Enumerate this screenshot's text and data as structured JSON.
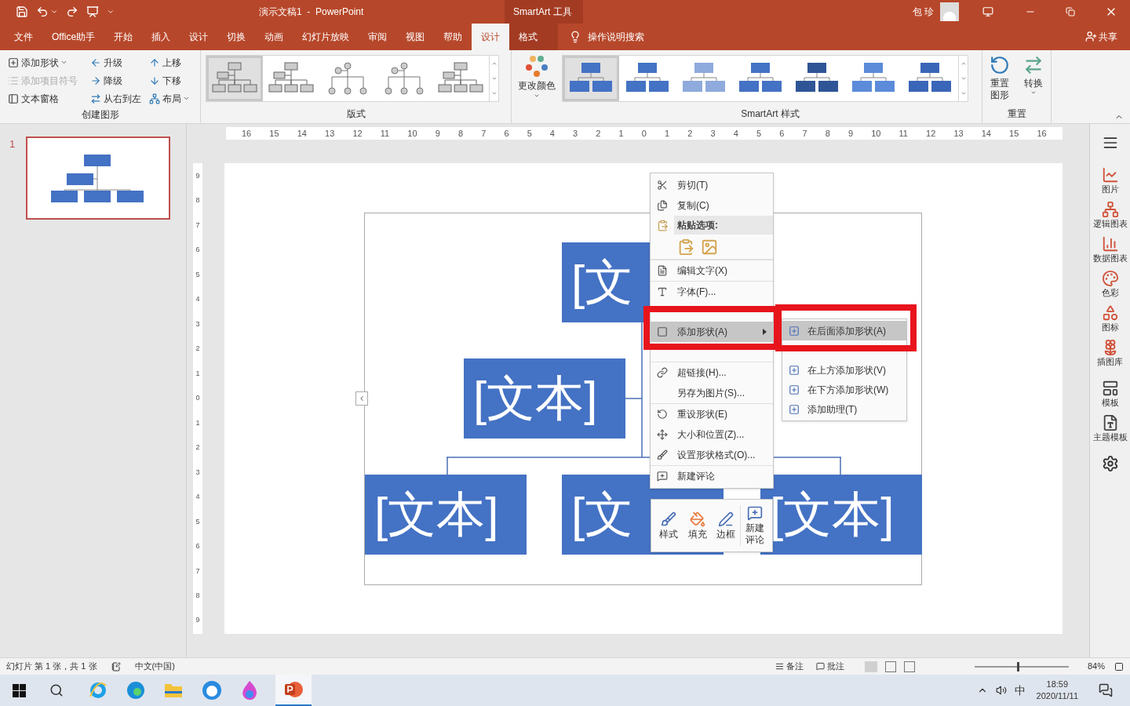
{
  "title_bar": {
    "title": "演示文稿1  -  PowerPoint",
    "context_group": "SmartArt 工具",
    "user": "包 珍"
  },
  "tabs": [
    {
      "label": "文件",
      "selected": false,
      "kind": "main"
    },
    {
      "label": "Office助手",
      "selected": false,
      "kind": "main"
    },
    {
      "label": "开始",
      "selected": false,
      "kind": "main"
    },
    {
      "label": "插入",
      "selected": false,
      "kind": "main"
    },
    {
      "label": "设计",
      "selected": false,
      "kind": "main"
    },
    {
      "label": "切换",
      "selected": false,
      "kind": "main"
    },
    {
      "label": "动画",
      "selected": false,
      "kind": "main"
    },
    {
      "label": "幻灯片放映",
      "selected": false,
      "kind": "main"
    },
    {
      "label": "审阅",
      "selected": false,
      "kind": "main"
    },
    {
      "label": "视图",
      "selected": false,
      "kind": "main"
    },
    {
      "label": "帮助",
      "selected": false,
      "kind": "main"
    },
    {
      "label": "设计",
      "selected": true,
      "kind": "context"
    },
    {
      "label": "格式",
      "selected": false,
      "kind": "context"
    }
  ],
  "search": "操作说明搜索",
  "share": "共享",
  "create_group": {
    "label": "创建图形",
    "items": [
      {
        "label": "添加形状",
        "disabled": false,
        "dropdown": true
      },
      {
        "label": "添加项目符号",
        "disabled": true,
        "dropdown": false
      },
      {
        "label": "文本窗格",
        "disabled": false,
        "dropdown": false
      },
      {
        "label": "升级",
        "disabled": false,
        "dropdown": false
      },
      {
        "label": "降级",
        "disabled": false,
        "dropdown": false
      },
      {
        "label": "从右到左",
        "disabled": false,
        "dropdown": false
      },
      {
        "label": "上移",
        "disabled": false,
        "dropdown": false
      },
      {
        "label": "下移",
        "disabled": false,
        "dropdown": false
      },
      {
        "label": "布局",
        "disabled": false,
        "dropdown": true
      }
    ]
  },
  "layout_group": {
    "label": "版式",
    "layouts": [
      {
        "selected": true
      },
      {
        "selected": false
      },
      {
        "selected": false
      },
      {
        "selected": false
      },
      {
        "selected": false
      }
    ]
  },
  "change_colors": "更改颜色",
  "styles_group": {
    "label": "SmartArt 样式",
    "styles": [
      {
        "selected": true
      },
      {
        "selected": false
      },
      {
        "selected": false
      },
      {
        "selected": false
      },
      {
        "selected": false
      },
      {
        "selected": false
      },
      {
        "selected": false
      }
    ]
  },
  "reset_group": {
    "label": "重置",
    "buttons": [
      "重置图形",
      "转换"
    ]
  },
  "slides": [
    {
      "number": "1",
      "selected": true
    }
  ],
  "ruler_h": [
    "16",
    "15",
    "14",
    "13",
    "12",
    "11",
    "10",
    "9",
    "8",
    "7",
    "6",
    "5",
    "4",
    "3",
    "2",
    "1",
    "0",
    "1",
    "2",
    "3",
    "4",
    "5",
    "6",
    "7",
    "8",
    "9",
    "10",
    "11",
    "12",
    "13",
    "14",
    "15",
    "16"
  ],
  "ruler_v": [
    "9",
    "8",
    "7",
    "6",
    "5",
    "4",
    "3",
    "2",
    "1",
    "0",
    "1",
    "2",
    "3",
    "4",
    "5",
    "6",
    "7",
    "8",
    "9"
  ],
  "smartart_nodes": [
    "[文",
    "[文本]",
    "[文本]",
    "[文",
    "[文本]"
  ],
  "context_menu": [
    {
      "kind": "item",
      "label": "剪切(T)",
      "selected": false
    },
    {
      "kind": "item",
      "label": "复制(C)",
      "selected": false
    },
    {
      "kind": "header",
      "label": "粘贴选项:",
      "selected": false
    },
    {
      "kind": "paste_icons",
      "selected": false
    },
    {
      "kind": "item",
      "label": "编辑文字(X)",
      "selected": false
    },
    {
      "kind": "item",
      "label": "字体(F)...",
      "selected": false
    },
    {
      "kind": "submenu",
      "label": "添加形状(A)",
      "selected": true
    },
    {
      "kind": "item",
      "label": "超链接(H)...",
      "selected": false
    },
    {
      "kind": "item",
      "label": "另存为图片(S)...",
      "selected": false
    },
    {
      "kind": "item",
      "label": "重设形状(E)",
      "selected": false
    },
    {
      "kind": "item",
      "label": "大小和位置(Z)...",
      "selected": false
    },
    {
      "kind": "item",
      "label": "设置形状格式(O)...",
      "selected": false
    },
    {
      "kind": "item",
      "label": "新建评论",
      "selected": false
    }
  ],
  "submenu": [
    {
      "label": "在后面添加形状(A)",
      "selected": true
    },
    {
      "label": "在上方添加形状(V)",
      "selected": false
    },
    {
      "label": "在下方添加形状(W)",
      "selected": false
    },
    {
      "label": "添加助理(T)",
      "selected": false
    }
  ],
  "mini_toolbar": [
    "样式",
    "填充",
    "边框",
    "新建评论"
  ],
  "right_sidebar": [
    "图片",
    "逻辑图表",
    "数据图表",
    "色彩",
    "图标",
    "插图库",
    "模板",
    "主题模板"
  ],
  "status_bar": {
    "slide_info": "幻灯片 第 1 张，共 1 张",
    "language": "中文(中国)",
    "notes": "备注",
    "comments": "批注",
    "zoom_slider": {
      "level": 0.45
    },
    "zoom": "84%"
  },
  "taskbar": {
    "ime": "中",
    "time": "18:59",
    "date": "2020/11/11"
  }
}
